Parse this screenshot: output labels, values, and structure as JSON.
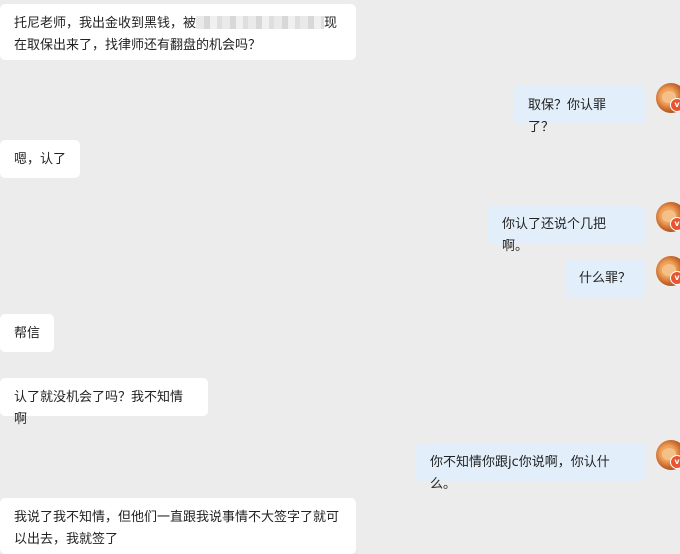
{
  "messages": [
    {
      "side": "left",
      "text_before": "托尼老师，我出金收到黑钱，被",
      "text_after": "现",
      "line2": "在取保出来了，找律师还有翻盘的机会吗？"
    },
    {
      "side": "right",
      "text": "取保？你认罪了？"
    },
    {
      "side": "left",
      "text": "嗯，认了"
    },
    {
      "side": "right",
      "text": "你认了还说个几把啊。"
    },
    {
      "side": "right",
      "text": "什么罪？"
    },
    {
      "side": "left",
      "text": "帮信"
    },
    {
      "side": "left",
      "text": "认了就没机会了吗？我不知情啊"
    },
    {
      "side": "right",
      "text": "你不知情你跟jc你说啊，你认什么。"
    },
    {
      "side": "left",
      "line1": "我说了我不知情，但他们一直跟我说事情不大签字了就可",
      "line2": "以出去，我就签了"
    }
  ],
  "avatar": {
    "icon": "user-avatar-icon",
    "badge_icon": "verified-v-badge-icon",
    "badge_text": "v"
  },
  "colors": {
    "background": "#ececec",
    "left_bubble": "#ffffff",
    "right_bubble": "#e2effb",
    "badge": "#e8542f"
  }
}
